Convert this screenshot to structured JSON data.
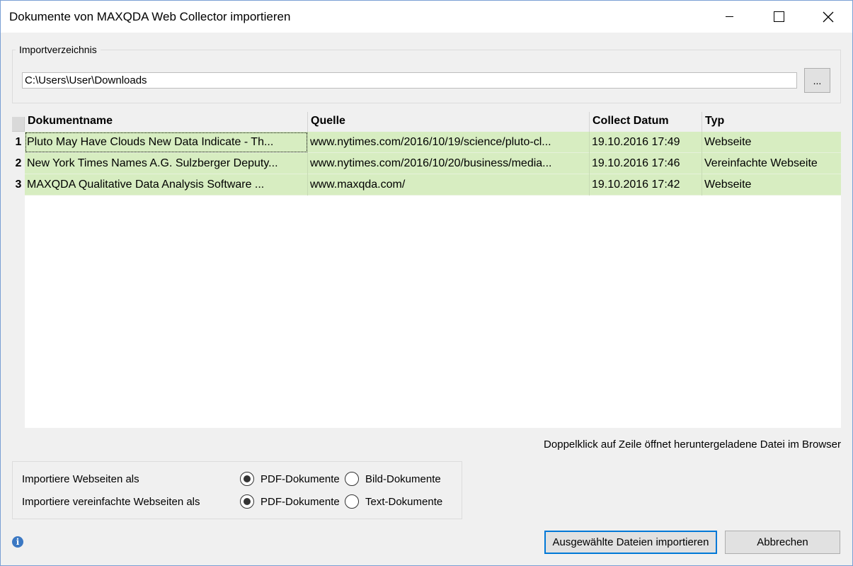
{
  "window": {
    "title": "Dokumente von MAXQDA Web Collector importieren"
  },
  "import_dir": {
    "legend": "Importverzeichnis",
    "path": "C:\\Users\\User\\Downloads",
    "browse_label": "..."
  },
  "table": {
    "columns": [
      "Dokumentname",
      "Quelle",
      "Collect Datum",
      "Typ"
    ],
    "rows": [
      {
        "num": "1",
        "name": "Pluto May Have Clouds New Data Indicate - Th...",
        "source": "www.nytimes.com/2016/10/19/science/pluto-cl...",
        "date": "19.10.2016 17:49",
        "type": "Webseite"
      },
      {
        "num": "2",
        "name": "New York Times Names A.G. Sulzberger Deputy...",
        "source": "www.nytimes.com/2016/10/20/business/media...",
        "date": "19.10.2016 17:46",
        "type": "Vereinfachte Webseite"
      },
      {
        "num": "3",
        "name": "MAXQDA Qualitative Data Analysis Software  ...",
        "source": "www.maxqda.com/",
        "date": "19.10.2016 17:42",
        "type": "Webseite"
      }
    ],
    "row_color": "#d7edc1"
  },
  "hint": "Doppelklick auf Zeile öffnet heruntergeladene Datei im Browser",
  "options": {
    "web_label": "Importiere Webseiten als",
    "web_opt1": "PDF-Dokumente",
    "web_opt2": "Bild-Dokumente",
    "simple_label": "Importiere vereinfachte Webseiten als",
    "simple_opt1": "PDF-Dokumente",
    "simple_opt2": "Text-Dokumente"
  },
  "buttons": {
    "import": "Ausgewählte Dateien importieren",
    "cancel": "Abbrechen"
  },
  "info_icon": "i",
  "accent": "#0078d7"
}
